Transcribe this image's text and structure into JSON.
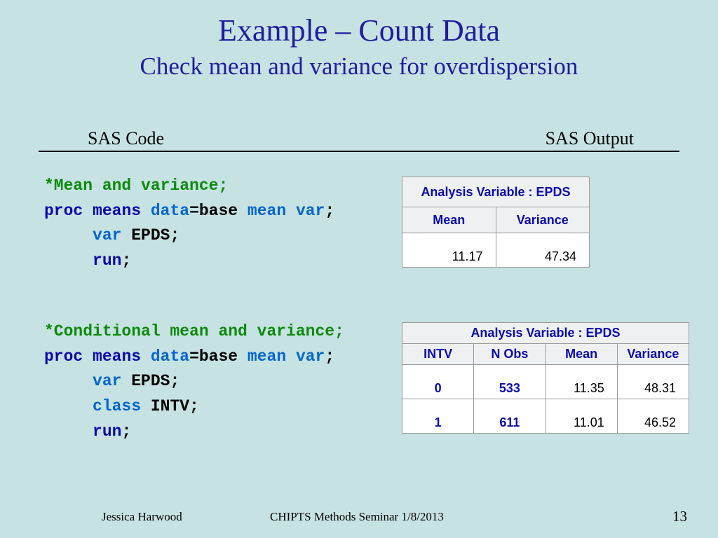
{
  "title": "Example – Count Data",
  "subtitle": "Check mean and variance for overdispersion",
  "col_left": "SAS Code",
  "col_right": "SAS Output",
  "code1": {
    "comment": "*Mean and variance",
    "kw_proc": "proc",
    "kw_means": "means",
    "opt_data": "data",
    "val_base": "=base ",
    "opt_mean": "mean",
    "opt_var": "var",
    "kw_var": "var",
    "var_name": " EPDS;",
    "kw_run": "run"
  },
  "code2": {
    "comment": "*Conditional mean and variance",
    "kw_proc": "proc",
    "kw_means": "means",
    "opt_data": "data",
    "val_base": "=base ",
    "opt_mean": "mean",
    "opt_var": "var",
    "kw_var": "var",
    "var_name": " EPDS;",
    "kw_class": "class",
    "class_name": " INTV;",
    "kw_run": "run"
  },
  "table1": {
    "title": "Analysis Variable : EPDS",
    "h_mean": "Mean",
    "h_var": "Variance",
    "mean": "11.17",
    "var": "47.34"
  },
  "table2": {
    "title": "Analysis Variable : EPDS",
    "h_intv": "INTV",
    "h_nobs": "N Obs",
    "h_mean": "Mean",
    "h_var": "Variance",
    "rows": [
      {
        "intv": "0",
        "nobs": "533",
        "mean": "11.35",
        "var": "48.31"
      },
      {
        "intv": "1",
        "nobs": "611",
        "mean": "11.01",
        "var": "46.52"
      }
    ]
  },
  "footer": {
    "author": "Jessica Harwood",
    "venue": "CHIPTS Methods Seminar 1/8/2013",
    "page": "13"
  }
}
